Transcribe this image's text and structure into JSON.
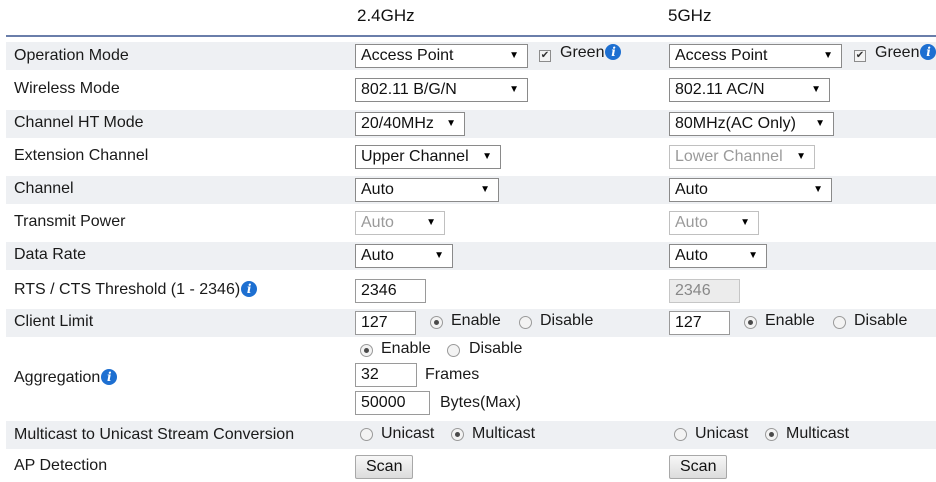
{
  "headers": {
    "band_24": "2.4GHz",
    "band_5": "5GHz"
  },
  "info_icon": "info-icon",
  "colors": {
    "header_rule": "#6a7eaa",
    "info_blue": "#1d6fd1",
    "row_alt": "#eef0f3"
  },
  "rows": {
    "operation_mode": {
      "label": "Operation Mode",
      "b24": {
        "value": "Access Point",
        "green_label": "Green",
        "green_checked": true
      },
      "b5": {
        "value": "Access Point",
        "green_label": "Green",
        "green_checked": true
      }
    },
    "wireless_mode": {
      "label": "Wireless Mode",
      "b24": "802.11 B/G/N",
      "b5": "802.11 AC/N"
    },
    "channel_ht_mode": {
      "label": "Channel HT Mode",
      "b24": "20/40MHz",
      "b5": "80MHz(AC Only)"
    },
    "extension_channel": {
      "label": "Extension Channel",
      "b24": "Upper Channel",
      "b5": "Lower Channel"
    },
    "channel": {
      "label": "Channel",
      "b24": "Auto",
      "b5": "Auto"
    },
    "transmit_power": {
      "label": "Transmit Power",
      "b24": "Auto",
      "b5": "Auto"
    },
    "data_rate": {
      "label": "Data Rate",
      "b24": "Auto",
      "b5": "Auto"
    },
    "rts_cts": {
      "label": "RTS / CTS Threshold (1 - 2346)",
      "b24": "2346",
      "b5": "2346"
    },
    "client_limit": {
      "label": "Client Limit",
      "b24": {
        "value": "127",
        "enable": "Enable",
        "disable": "Disable",
        "selected": "Enable"
      },
      "b5": {
        "value": "127",
        "enable": "Enable",
        "disable": "Disable",
        "selected": "Enable"
      }
    },
    "aggregation": {
      "label": "Aggregation",
      "enable": "Enable",
      "disable": "Disable",
      "selected": "Enable",
      "frames_value": "32",
      "frames_label": "Frames",
      "bytes_value": "50000",
      "bytes_label": "Bytes(Max)"
    },
    "multicast": {
      "label": "Multicast to Unicast Stream Conversion",
      "b24": {
        "unicast": "Unicast",
        "multicast": "Multicast",
        "selected": "Multicast"
      },
      "b5": {
        "unicast": "Unicast",
        "multicast": "Multicast",
        "selected": "Multicast"
      }
    },
    "ap_detection": {
      "label": "AP Detection",
      "b24_button": "Scan",
      "b5_button": "Scan"
    }
  }
}
